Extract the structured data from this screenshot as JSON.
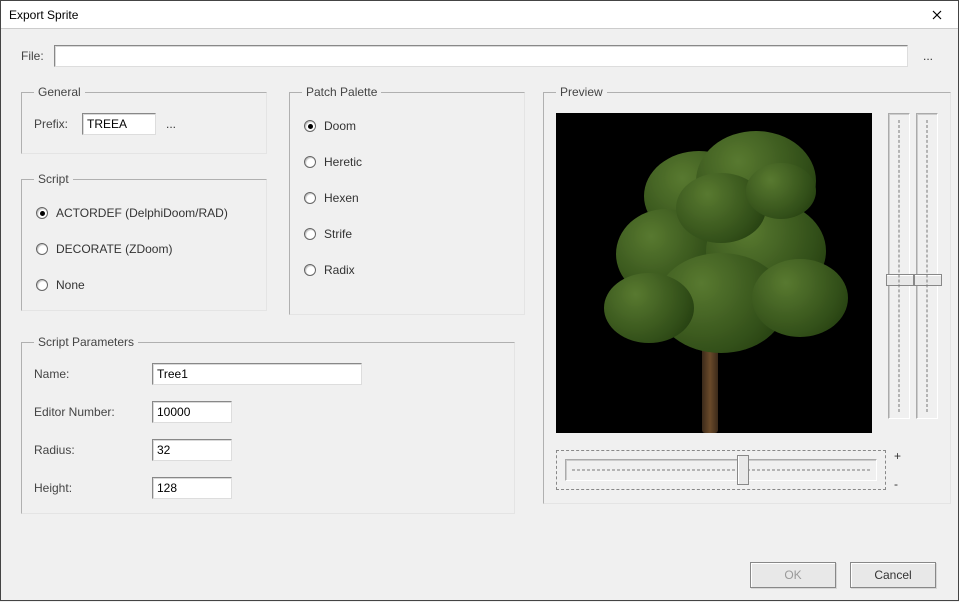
{
  "window": {
    "title": "Export Sprite"
  },
  "file": {
    "label": "File:",
    "value": "",
    "browse": "..."
  },
  "general": {
    "legend": "General",
    "prefix_label": "Prefix:",
    "prefix_value": "TREEA",
    "ell": "..."
  },
  "script": {
    "legend": "Script",
    "options": [
      {
        "label": "ACTORDEF (DelphiDoom/RAD)",
        "selected": true
      },
      {
        "label": "DECORATE (ZDoom)",
        "selected": false
      },
      {
        "label": "None",
        "selected": false
      }
    ]
  },
  "palette": {
    "legend": "Patch Palette",
    "options": [
      {
        "label": "Doom",
        "selected": true
      },
      {
        "label": "Heretic",
        "selected": false
      },
      {
        "label": "Hexen",
        "selected": false
      },
      {
        "label": "Strife",
        "selected": false
      },
      {
        "label": "Radix",
        "selected": false
      }
    ]
  },
  "params": {
    "legend": "Script Parameters",
    "name_label": "Name:",
    "name_value": "Tree1",
    "editor_label": "Editor Number:",
    "editor_value": "10000",
    "radius_label": "Radius:",
    "radius_value": "32",
    "height_label": "Height:",
    "height_value": "128"
  },
  "preview": {
    "legend": "Preview",
    "plus": "+",
    "minus": "-"
  },
  "buttons": {
    "ok": "OK",
    "cancel": "Cancel"
  }
}
